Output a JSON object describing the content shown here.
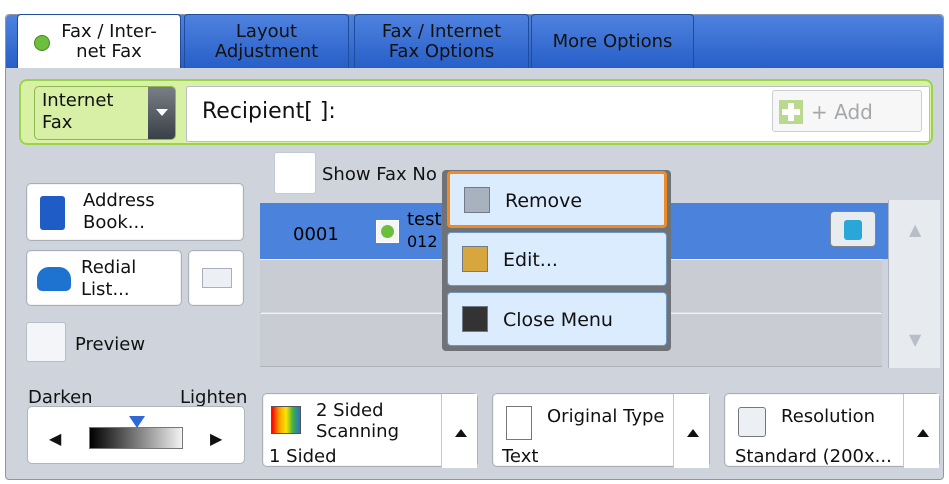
{
  "tabs": [
    {
      "label": "Fax / Inter-\nnet Fax"
    },
    {
      "label": "Layout\nAdjustment"
    },
    {
      "label": "Fax / Internet\nFax Options"
    },
    {
      "label": "More Options"
    }
  ],
  "recipient": {
    "type_selector": "Internet\nFax",
    "label": "Recipient[   ]:",
    "add_label": "+ Add"
  },
  "sidebar": {
    "address_book": "Address\nBook...",
    "redial_list": "Redial\nList...",
    "preview": "Preview"
  },
  "list": {
    "show_label": "Show Fax No",
    "selected_number": "0001",
    "selected_name": "test",
    "selected_detail": "012"
  },
  "menu": {
    "remove": "Remove",
    "edit": "Edit...",
    "close": "Close Menu"
  },
  "bottom": {
    "darken": "Darken",
    "lighten": "Lighten",
    "scanning_title": "2 Sided\nScanning",
    "scanning_value": "1 Sided",
    "original_title": "Original Type",
    "original_value": "Text",
    "resolution_title": "Resolution",
    "resolution_value": "Standard (200x..."
  },
  "colors": {
    "blue_tab": "#275fc8",
    "green_bar": "#d8f1a4",
    "highlight": "#f08a24"
  }
}
